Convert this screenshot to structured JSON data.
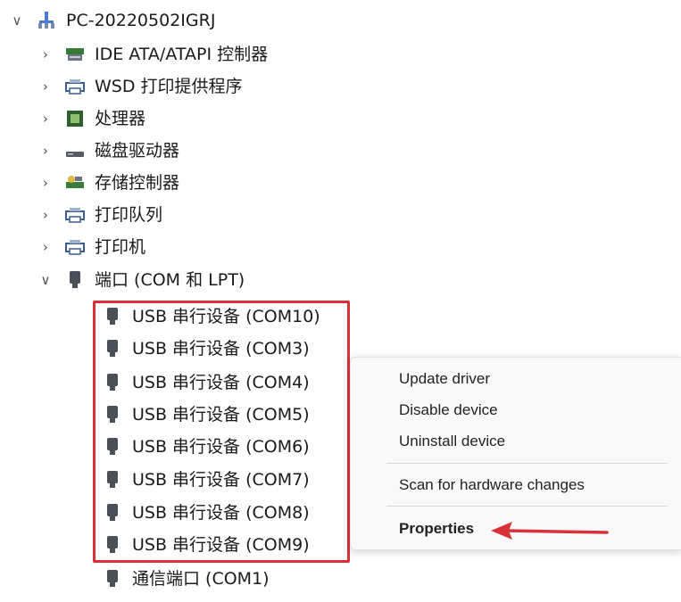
{
  "tree": {
    "root": {
      "label": "PC-20220502IGRJ",
      "expanded": true,
      "icon": "computer-icon"
    },
    "categories": [
      {
        "label": "IDE ATA/ATAPI 控制器",
        "icon": "ide-controller-icon",
        "expanded": false
      },
      {
        "label": "WSD 打印提供程序",
        "icon": "printer-icon",
        "expanded": false
      },
      {
        "label": "处理器",
        "icon": "processor-icon",
        "expanded": false
      },
      {
        "label": "磁盘驱动器",
        "icon": "disk-drive-icon",
        "expanded": false
      },
      {
        "label": "存储控制器",
        "icon": "storage-controller-icon",
        "expanded": false
      },
      {
        "label": "打印队列",
        "icon": "printer-icon",
        "expanded": false
      },
      {
        "label": "打印机",
        "icon": "printer-icon",
        "expanded": false
      },
      {
        "label": "端口 (COM 和 LPT)",
        "icon": "port-icon",
        "expanded": true
      }
    ],
    "ports": [
      {
        "label": "USB 串行设备 (COM10)"
      },
      {
        "label": "USB 串行设备 (COM3)"
      },
      {
        "label": "USB 串行设备 (COM4)"
      },
      {
        "label": "USB 串行设备 (COM5)"
      },
      {
        "label": "USB 串行设备 (COM6)"
      },
      {
        "label": "USB 串行设备 (COM7)"
      },
      {
        "label": "USB 串行设备 (COM8)"
      },
      {
        "label": "USB 串行设备 (COM9)"
      },
      {
        "label": "通信端口 (COM1)"
      }
    ]
  },
  "context_menu": {
    "items": [
      {
        "label": "Update driver"
      },
      {
        "label": "Disable device"
      },
      {
        "label": "Uninstall device"
      },
      {
        "label": "Scan for hardware changes"
      },
      {
        "label": "Properties",
        "bold": true
      }
    ]
  },
  "colors": {
    "highlight": "#d9313a",
    "arrow": "#d9313a"
  }
}
